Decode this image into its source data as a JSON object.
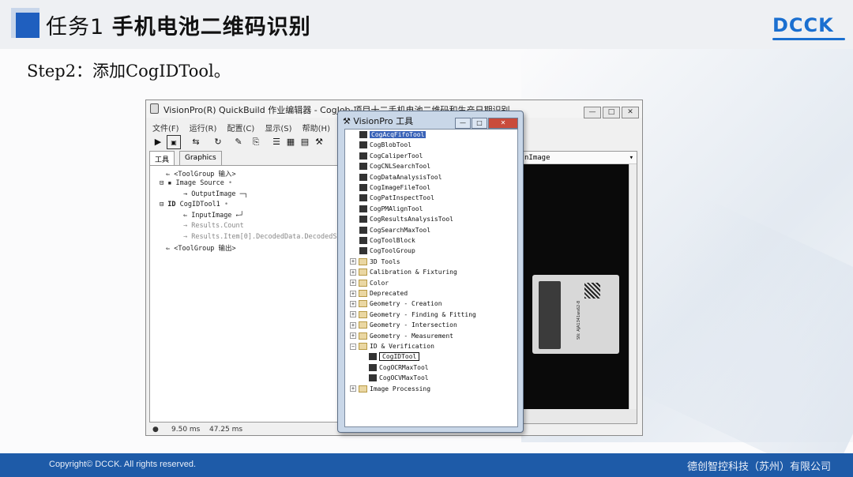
{
  "slide": {
    "title_prefix": "任务1",
    "title_main": "手机电池二维码识别",
    "logo": "DCCK",
    "step": "Step2：添加CogIDTool。",
    "footer_copyright": "Copyright© DCCK. All rights reserved.",
    "footer_company": "德创智控科技（苏州）有限公司"
  },
  "main_window": {
    "title": "VisionPro(R) QuickBuild 作业编辑器 - CogJob-项目十二手机电池二维码和生产日期识别",
    "menu": [
      "文件(F)",
      "运行(R)",
      "配置(C)",
      "显示(S)",
      "帮助(H)"
    ],
    "toolbar_icons": [
      "run-icon",
      "camera-icon",
      "loop-icon",
      "reset-icon",
      "wand-icon",
      "copy-icon",
      "image-icon",
      "display-icon",
      "tools-icon"
    ],
    "tabs": [
      "工具",
      "Graphics"
    ],
    "image_tab": "nImage",
    "tree": [
      "<ToolGroup 输入>",
      "Image Source",
      "OutputImage",
      "CogIDTool1",
      "InputImage",
      "Results.Count",
      "Results.Item[0].DecodedData.DecodedS",
      "<ToolGroup 输出>"
    ],
    "status": [
      "9.50 ms",
      "47.25 ms"
    ],
    "label_text": "SN: AJA1341ws62-8"
  },
  "tools_window": {
    "title": "VisionPro 工具",
    "items": [
      {
        "label": "CogAcqFifoTool",
        "kind": "tool",
        "selected": true
      },
      {
        "label": "CogBlobTool",
        "kind": "tool"
      },
      {
        "label": "CogCaliperTool",
        "kind": "tool"
      },
      {
        "label": "CogCNLSearchTool",
        "kind": "tool"
      },
      {
        "label": "CogDataAnalysisTool",
        "kind": "tool"
      },
      {
        "label": "CogImageFileTool",
        "kind": "tool"
      },
      {
        "label": "CogPatInspectTool",
        "kind": "tool"
      },
      {
        "label": "CogPMAlignTool",
        "kind": "tool"
      },
      {
        "label": "CogResultsAnalysisTool",
        "kind": "tool"
      },
      {
        "label": "CogSearchMaxTool",
        "kind": "tool"
      },
      {
        "label": "CogToolBlock",
        "kind": "tool"
      },
      {
        "label": "CogToolGroup",
        "kind": "tool"
      },
      {
        "label": "3D Tools",
        "kind": "folder"
      },
      {
        "label": "Calibration & Fixturing",
        "kind": "folder"
      },
      {
        "label": "Color",
        "kind": "folder"
      },
      {
        "label": "Deprecated",
        "kind": "folder"
      },
      {
        "label": "Geometry - Creation",
        "kind": "folder"
      },
      {
        "label": "Geometry - Finding & Fitting",
        "kind": "folder"
      },
      {
        "label": "Geometry - Intersection",
        "kind": "folder"
      },
      {
        "label": "Geometry - Measurement",
        "kind": "folder"
      },
      {
        "label": "ID & Verification",
        "kind": "folder-open"
      },
      {
        "label": "CogIDTool",
        "kind": "subtool",
        "highlight": true
      },
      {
        "label": "CogOCRMaxTool",
        "kind": "subtool"
      },
      {
        "label": "CogOCVMaxTool",
        "kind": "subtool"
      },
      {
        "label": "Image Processing",
        "kind": "folder"
      }
    ]
  }
}
